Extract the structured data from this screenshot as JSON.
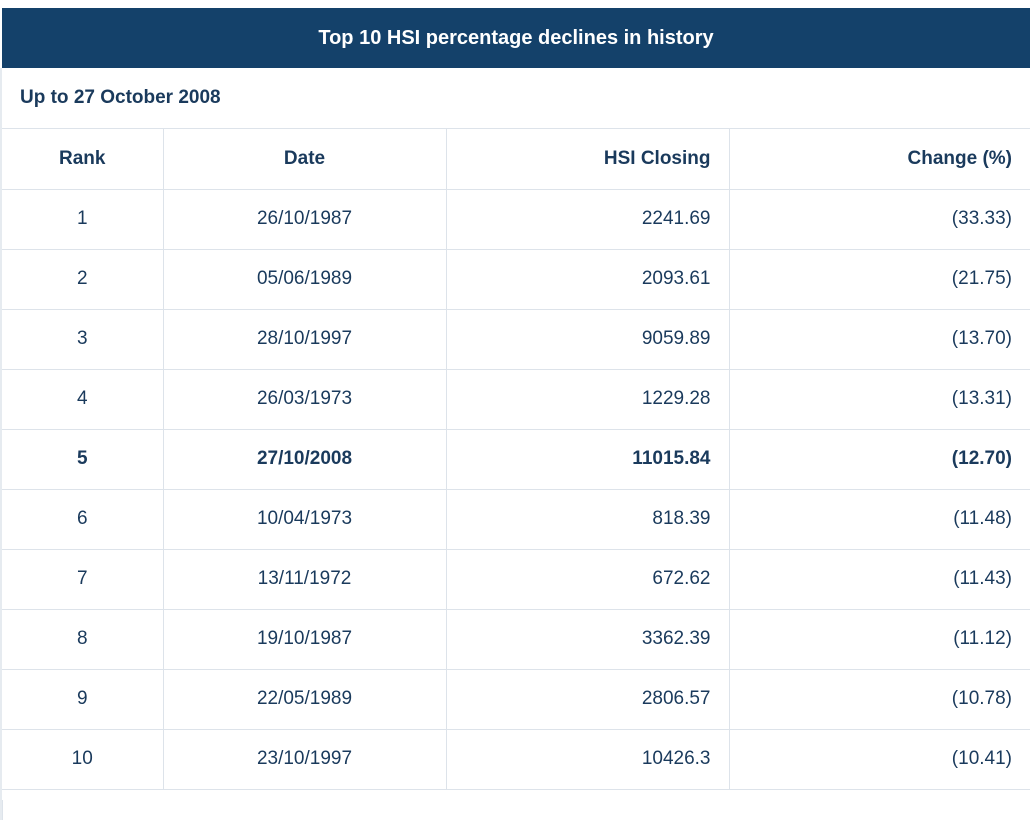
{
  "title": "Top 10 HSI percentage declines in history",
  "subtitle": "Up to 27 October 2008",
  "columns": {
    "rank": "Rank",
    "date": "Date",
    "closing": "HSI Closing",
    "change": "Change (%)"
  },
  "rows": [
    {
      "rank": "1",
      "date": "26/10/1987",
      "closing": "2241.69",
      "change": "(33.33)",
      "highlight": false
    },
    {
      "rank": "2",
      "date": "05/06/1989",
      "closing": "2093.61",
      "change": "(21.75)",
      "highlight": false
    },
    {
      "rank": "3",
      "date": "28/10/1997",
      "closing": "9059.89",
      "change": "(13.70)",
      "highlight": false
    },
    {
      "rank": "4",
      "date": "26/03/1973",
      "closing": "1229.28",
      "change": "(13.31)",
      "highlight": false
    },
    {
      "rank": "5",
      "date": "27/10/2008",
      "closing": "11015.84",
      "change": "(12.70)",
      "highlight": true
    },
    {
      "rank": "6",
      "date": "10/04/1973",
      "closing": "818.39",
      "change": "(11.48)",
      "highlight": false
    },
    {
      "rank": "7",
      "date": "13/11/1972",
      "closing": "672.62",
      "change": "(11.43)",
      "highlight": false
    },
    {
      "rank": "8",
      "date": "19/10/1987",
      "closing": "3362.39",
      "change": "(11.12)",
      "highlight": false
    },
    {
      "rank": "9",
      "date": "22/05/1989",
      "closing": "2806.57",
      "change": "(10.78)",
      "highlight": false
    },
    {
      "rank": "10",
      "date": "23/10/1997",
      "closing": "10426.3",
      "change": "(10.41)",
      "highlight": false
    }
  ],
  "colors": {
    "header_bg": "#14416a",
    "text": "#1a3a5c",
    "border": "#dde3ea"
  }
}
